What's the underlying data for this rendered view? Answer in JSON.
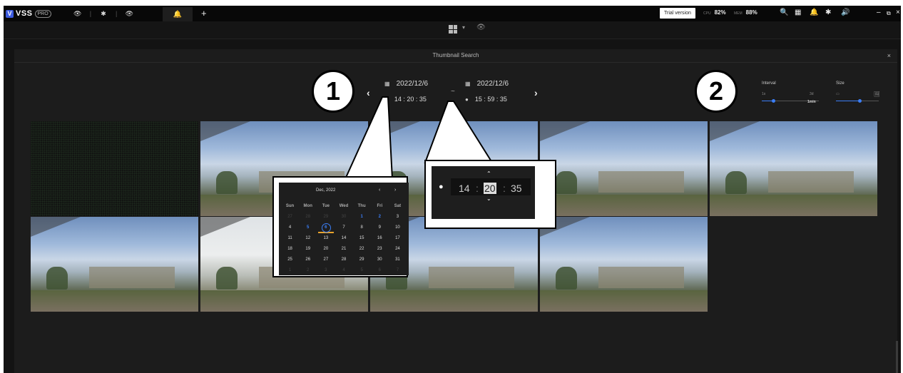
{
  "app": {
    "name": "VSS",
    "edition": "PRO",
    "logo_letter": "V"
  },
  "topbar": {
    "tabs": [
      {
        "icon": "eye-icon",
        "glyph": "👁"
      },
      {
        "icon": "gear-icon",
        "glyph": "✱"
      },
      {
        "icon": "eye-icon",
        "glyph": "👁"
      },
      {
        "icon": "bell-icon",
        "glyph": "🔔"
      }
    ],
    "add_tab": "+",
    "trial_label": "Trial version",
    "cpu_label": "CPU",
    "cpu_value": "82%",
    "mem_label": "MEM",
    "mem_value": "88%",
    "right_icons": [
      {
        "icon": "search-icon",
        "glyph": "🔍"
      },
      {
        "icon": "grid-icon",
        "glyph": "▦"
      },
      {
        "icon": "bell-icon",
        "glyph": "🔔"
      },
      {
        "icon": "gear-icon",
        "glyph": "✱"
      },
      {
        "icon": "volume-icon",
        "glyph": "🔊"
      }
    ],
    "window_controls": {
      "minimize": "–",
      "restore": "⧉",
      "close": "×"
    }
  },
  "dialog": {
    "title": "Thumbnail Search",
    "close": "×",
    "start_date": "2022/12/6",
    "end_date": "2022/12/6",
    "start_time": "14 : 20 : 35",
    "end_time": "15 : 59 : 35",
    "range_sep": "~",
    "interval": {
      "label": "Interval",
      "min": "1s",
      "max": "3d",
      "value_label": "1min",
      "level": 0.2
    },
    "size": {
      "label": "Size",
      "level": 0.55
    }
  },
  "callouts": {
    "one": "1",
    "two": "2"
  },
  "calendar": {
    "month_label": "Dec, 2022",
    "prev": "‹",
    "next": "›",
    "weekdays": [
      "Sun",
      "Mon",
      "Tue",
      "Wed",
      "Thu",
      "Fri",
      "Sat"
    ],
    "days": [
      {
        "d": "27",
        "s": "dim"
      },
      {
        "d": "28",
        "s": "dim"
      },
      {
        "d": "29",
        "s": "dim"
      },
      {
        "d": "30",
        "s": "dim"
      },
      {
        "d": "1",
        "s": "hl"
      },
      {
        "d": "2",
        "s": "hl"
      },
      {
        "d": "3",
        "s": ""
      },
      {
        "d": "4",
        "s": ""
      },
      {
        "d": "5",
        "s": "hl"
      },
      {
        "d": "6",
        "s": "sel hl"
      },
      {
        "d": "7",
        "s": ""
      },
      {
        "d": "8",
        "s": ""
      },
      {
        "d": "9",
        "s": ""
      },
      {
        "d": "10",
        "s": ""
      },
      {
        "d": "11",
        "s": ""
      },
      {
        "d": "12",
        "s": ""
      },
      {
        "d": "13",
        "s": ""
      },
      {
        "d": "14",
        "s": ""
      },
      {
        "d": "15",
        "s": ""
      },
      {
        "d": "16",
        "s": ""
      },
      {
        "d": "17",
        "s": ""
      },
      {
        "d": "18",
        "s": ""
      },
      {
        "d": "19",
        "s": ""
      },
      {
        "d": "20",
        "s": ""
      },
      {
        "d": "21",
        "s": ""
      },
      {
        "d": "22",
        "s": ""
      },
      {
        "d": "23",
        "s": ""
      },
      {
        "d": "24",
        "s": ""
      },
      {
        "d": "25",
        "s": ""
      },
      {
        "d": "26",
        "s": ""
      },
      {
        "d": "27",
        "s": ""
      },
      {
        "d": "28",
        "s": ""
      },
      {
        "d": "29",
        "s": ""
      },
      {
        "d": "30",
        "s": ""
      },
      {
        "d": "31",
        "s": ""
      },
      {
        "d": "1",
        "s": "dim"
      },
      {
        "d": "2",
        "s": "dim"
      },
      {
        "d": "3",
        "s": "dim"
      },
      {
        "d": "4",
        "s": "dim"
      },
      {
        "d": "5",
        "s": "dim"
      },
      {
        "d": "6",
        "s": "dim"
      },
      {
        "d": "7",
        "s": "dim"
      }
    ]
  },
  "time_picker": {
    "hour": "14",
    "minute": "20",
    "second": "35",
    "sep": ":",
    "up": "⌃",
    "down": "⌄"
  },
  "thumbnails": [
    {
      "style": "noise"
    },
    {
      "style": "cam"
    },
    {
      "style": "cam"
    },
    {
      "style": "cam"
    },
    {
      "style": "cam"
    },
    {
      "style": "cam"
    },
    {
      "style": "bright"
    },
    {
      "style": "cam"
    },
    {
      "style": "cam"
    }
  ],
  "colors": {
    "accent": "#3b7ef6",
    "today_underline": "#e8a32c",
    "logo": "#3d5ce0"
  }
}
